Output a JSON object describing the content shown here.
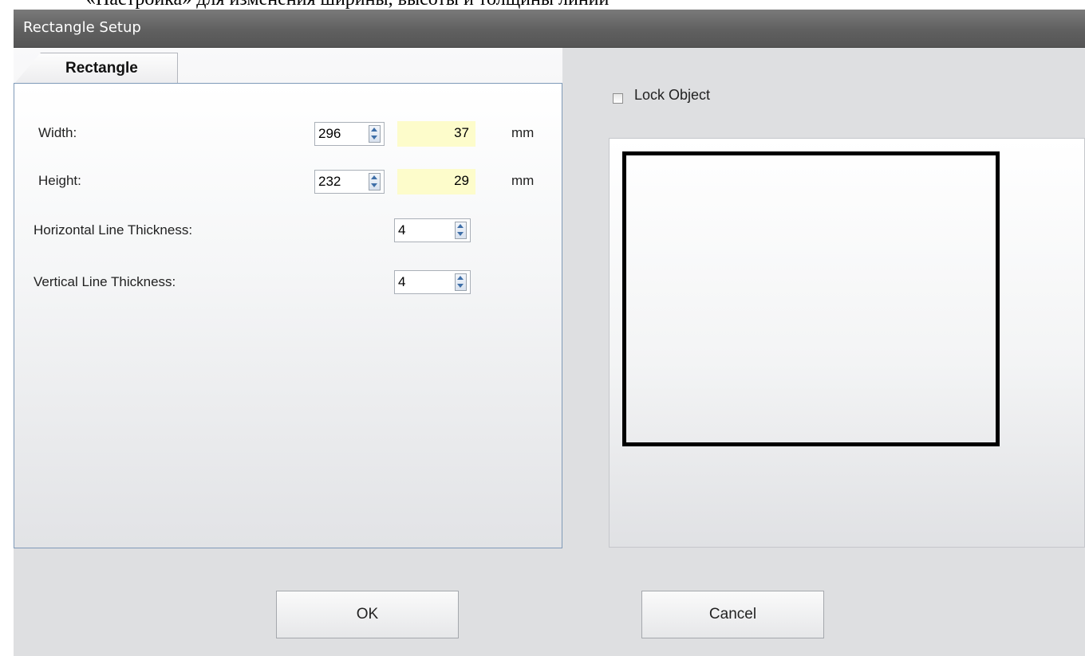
{
  "doc_caption": "«Настройка» для изменения ширины, высоты и толщины линии",
  "window": {
    "title": "Rectangle Setup"
  },
  "tabs": [
    {
      "label": "Rectangle"
    }
  ],
  "fields": {
    "width": {
      "label": "Width:",
      "value": "296",
      "converted": "37",
      "unit": "mm"
    },
    "height": {
      "label": "Height:",
      "value": "232",
      "converted": "29",
      "unit": "mm"
    },
    "horizontal_thickness": {
      "label": "Horizontal Line Thickness:",
      "value": "4"
    },
    "vertical_thickness": {
      "label": "Vertical Line Thickness:",
      "value": "4"
    }
  },
  "lock": {
    "label": "Lock Object",
    "checked": false
  },
  "buttons": {
    "ok": "OK",
    "cancel": "Cancel"
  },
  "colors": {
    "highlight": "#fdfccb",
    "titlebar": "#606060",
    "panel_border": "#7f9ab8",
    "spin_arrow": "#3f6fa8"
  }
}
